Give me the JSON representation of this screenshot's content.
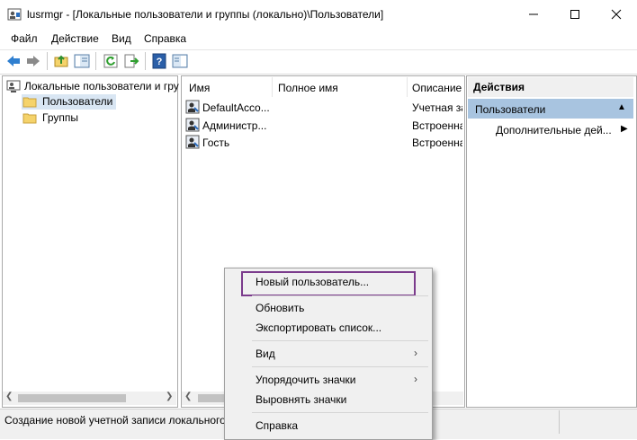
{
  "window": {
    "title": "lusrmgr - [Локальные пользователи и группы (локально)\\Пользователи]",
    "minimize_glyph": "—",
    "maximize_glyph": "☐",
    "close_glyph": "✕"
  },
  "menu": [
    "Файл",
    "Действие",
    "Вид",
    "Справка"
  ],
  "toolbar_icons": [
    "back-arrow-icon",
    "forward-arrow-icon",
    "up-folder-icon",
    "show-tree-icon",
    "refresh-icon",
    "export-list-icon",
    "help-icon",
    "properties-icon"
  ],
  "tree": {
    "root": "Локальные пользователи и гру",
    "children": [
      "Пользователи",
      "Группы"
    ]
  },
  "list": {
    "columns": [
      "Имя",
      "Полное имя",
      "Описание"
    ],
    "rows": [
      {
        "name": "DefaultAcco...",
        "full_name": "",
        "description": "Учетная запи"
      },
      {
        "name": "Администр...",
        "full_name": "",
        "description": "Встроенна"
      },
      {
        "name": "Гость",
        "full_name": "",
        "description": "Встроенна"
      }
    ]
  },
  "actions": {
    "header": "Действия",
    "section": "Пользователи",
    "more": "Дополнительные дей..."
  },
  "status": {
    "text": "Создание новой учетной записи локального"
  },
  "context_menu": {
    "new_user": "Новый пользователь...",
    "refresh": "Обновить",
    "export": "Экспортировать список...",
    "view": "Вид",
    "arrange": "Упорядочить значки",
    "line_up": "Выровнять значки",
    "help": "Справка",
    "highlight_color": "#7b3b8c"
  },
  "colors": {
    "selection": "#a8c4e0",
    "folder": "#f5d36b"
  }
}
